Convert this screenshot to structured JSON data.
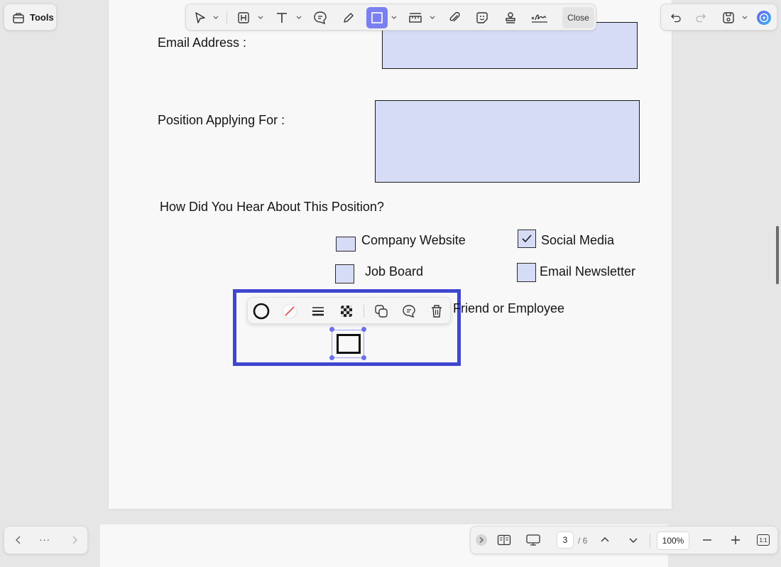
{
  "header": {
    "tools_label": "Tools",
    "close_label": "Close"
  },
  "form": {
    "email_label": "Email Address :",
    "position_label": "Position Applying For :",
    "question": "How Did You Hear About This Position?",
    "options": {
      "company_website": "Company Website",
      "social_media": "Social Media",
      "job_board": "Job Board",
      "email_newsletter": "Email Newsletter",
      "friend_employee": "Friend or Employee"
    },
    "social_media_checked": true
  },
  "footer": {
    "more_label": "···",
    "page_current": "3",
    "page_total": "/ 6",
    "zoom": "100%",
    "fit_label": "1:1"
  },
  "colors": {
    "accent": "#3f46cf",
    "field_fill": "#d6dcf6",
    "active_tool": "#7b80f0"
  }
}
